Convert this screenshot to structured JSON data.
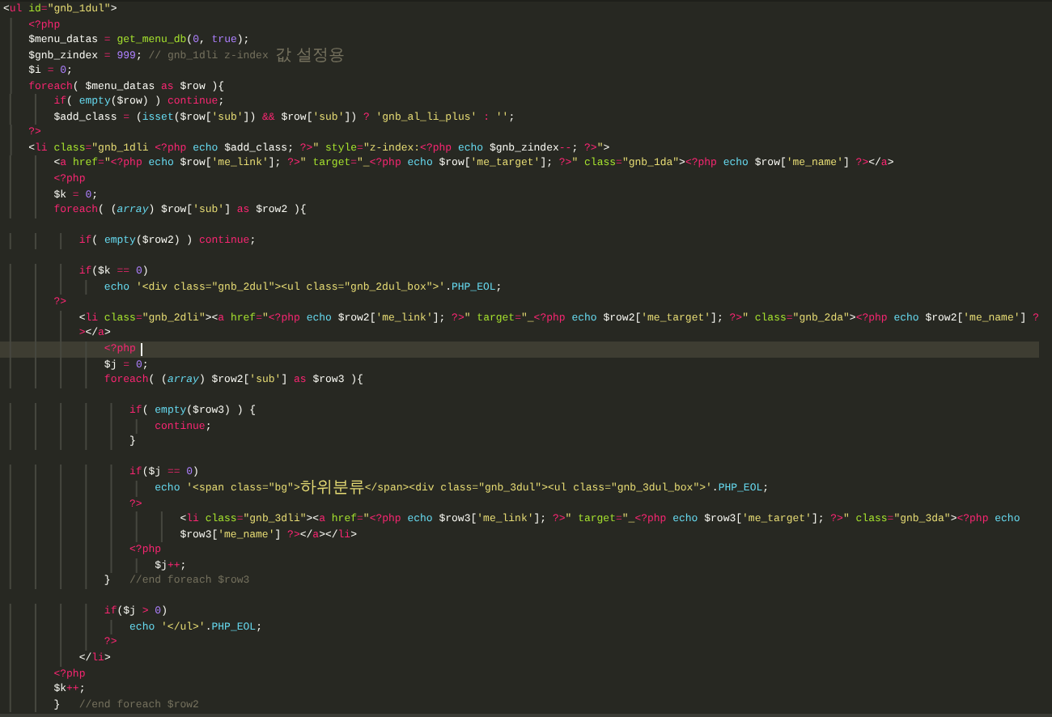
{
  "editor": {
    "lines": [
      {
        "current": false,
        "tokens": [
          {
            "kind": "w",
            "text": "<"
          },
          {
            "kind": "t",
            "text": "ul "
          },
          {
            "kind": "g",
            "text": "id"
          },
          {
            "kind": "t",
            "text": "="
          },
          {
            "kind": "y",
            "text": "\"gnb_1dul\""
          },
          {
            "kind": "w",
            "text": ">"
          }
        ]
      },
      {
        "current": false,
        "tokens": [
          {
            "kind": "t",
            "text": "    <?php"
          }
        ]
      },
      {
        "current": false,
        "tokens": [
          {
            "kind": "w",
            "text": "    $menu_datas "
          },
          {
            "kind": "t",
            "text": "= "
          },
          {
            "kind": "g",
            "text": "get_menu_db"
          },
          {
            "kind": "w",
            "text": "("
          },
          {
            "kind": "v",
            "text": "0"
          },
          {
            "kind": "w",
            "text": ", "
          },
          {
            "kind": "v",
            "text": "true"
          },
          {
            "kind": "w",
            "text": ");"
          }
        ]
      },
      {
        "current": false,
        "tokens": [
          {
            "kind": "w",
            "text": "    $gnb_zindex "
          },
          {
            "kind": "t",
            "text": "= "
          },
          {
            "kind": "v",
            "text": "999"
          },
          {
            "kind": "w",
            "text": "; "
          },
          {
            "kind": "c",
            "text": "// gnb_1dli z-index "
          },
          {
            "kind": "ck",
            "text": "값 설정용"
          }
        ]
      },
      {
        "current": false,
        "tokens": [
          {
            "kind": "w",
            "text": "    $i "
          },
          {
            "kind": "t",
            "text": "= "
          },
          {
            "kind": "v",
            "text": "0"
          },
          {
            "kind": "w",
            "text": ";"
          }
        ]
      },
      {
        "current": false,
        "tokens": [
          {
            "kind": "t",
            "text": "    foreach"
          },
          {
            "kind": "w",
            "text": "( $menu_datas "
          },
          {
            "kind": "t",
            "text": "as"
          },
          {
            "kind": "w",
            "text": " $row ){"
          }
        ]
      },
      {
        "current": false,
        "tokens": [
          {
            "kind": "t",
            "text": "        if"
          },
          {
            "kind": "w",
            "text": "( "
          },
          {
            "kind": "b",
            "text": "empty"
          },
          {
            "kind": "w",
            "text": "($row) ) "
          },
          {
            "kind": "t",
            "text": "continue"
          },
          {
            "kind": "w",
            "text": ";"
          }
        ]
      },
      {
        "current": false,
        "tokens": [
          {
            "kind": "w",
            "text": "        $add_class "
          },
          {
            "kind": "t",
            "text": "="
          },
          {
            "kind": "w",
            "text": " ("
          },
          {
            "kind": "b",
            "text": "isset"
          },
          {
            "kind": "w",
            "text": "($row["
          },
          {
            "kind": "y",
            "text": "'sub'"
          },
          {
            "kind": "w",
            "text": "]) "
          },
          {
            "kind": "t",
            "text": "&&"
          },
          {
            "kind": "w",
            "text": " $row["
          },
          {
            "kind": "y",
            "text": "'sub'"
          },
          {
            "kind": "w",
            "text": "]) "
          },
          {
            "kind": "t",
            "text": "? "
          },
          {
            "kind": "y",
            "text": "'gnb_al_li_plus' "
          },
          {
            "kind": "t",
            "text": ": "
          },
          {
            "kind": "y",
            "text": "''"
          },
          {
            "kind": "w",
            "text": ";"
          }
        ]
      },
      {
        "current": false,
        "tokens": [
          {
            "kind": "t",
            "text": "    ?>"
          }
        ]
      },
      {
        "current": false,
        "tokens": [
          {
            "kind": "w",
            "text": "    <"
          },
          {
            "kind": "t",
            "text": "li "
          },
          {
            "kind": "g",
            "text": "class"
          },
          {
            "kind": "t",
            "text": "="
          },
          {
            "kind": "y",
            "text": "\"gnb_1dli "
          },
          {
            "kind": "t",
            "text": "<?php "
          },
          {
            "kind": "b",
            "text": "echo"
          },
          {
            "kind": "w",
            "text": " $add_class; "
          },
          {
            "kind": "t",
            "text": "?>"
          },
          {
            "kind": "y",
            "text": "\" "
          },
          {
            "kind": "g",
            "text": "style"
          },
          {
            "kind": "t",
            "text": "="
          },
          {
            "kind": "y",
            "text": "\"z-index:"
          },
          {
            "kind": "t",
            "text": "<?php "
          },
          {
            "kind": "b",
            "text": "echo"
          },
          {
            "kind": "w",
            "text": " $gnb_zindex"
          },
          {
            "kind": "t",
            "text": "--"
          },
          {
            "kind": "w",
            "text": "; "
          },
          {
            "kind": "t",
            "text": "?>"
          },
          {
            "kind": "y",
            "text": "\""
          },
          {
            "kind": "w",
            "text": ">"
          }
        ]
      },
      {
        "current": false,
        "tokens": [
          {
            "kind": "w",
            "text": "        <"
          },
          {
            "kind": "t",
            "text": "a "
          },
          {
            "kind": "g",
            "text": "href"
          },
          {
            "kind": "t",
            "text": "="
          },
          {
            "kind": "y",
            "text": "\""
          },
          {
            "kind": "t",
            "text": "<?php "
          },
          {
            "kind": "b",
            "text": "echo"
          },
          {
            "kind": "w",
            "text": " $row["
          },
          {
            "kind": "y",
            "text": "'me_link'"
          },
          {
            "kind": "w",
            "text": "]; "
          },
          {
            "kind": "t",
            "text": "?>"
          },
          {
            "kind": "y",
            "text": "\" "
          },
          {
            "kind": "g",
            "text": "target"
          },
          {
            "kind": "t",
            "text": "="
          },
          {
            "kind": "y",
            "text": "\"_"
          },
          {
            "kind": "t",
            "text": "<?php "
          },
          {
            "kind": "b",
            "text": "echo"
          },
          {
            "kind": "w",
            "text": " $row["
          },
          {
            "kind": "y",
            "text": "'me_target'"
          },
          {
            "kind": "w",
            "text": "]; "
          },
          {
            "kind": "t",
            "text": "?>"
          },
          {
            "kind": "y",
            "text": "\" "
          },
          {
            "kind": "g",
            "text": "class"
          },
          {
            "kind": "t",
            "text": "="
          },
          {
            "kind": "y",
            "text": "\"gnb_1da\""
          },
          {
            "kind": "w",
            "text": ">"
          },
          {
            "kind": "t",
            "text": "<?php "
          },
          {
            "kind": "b",
            "text": "echo"
          },
          {
            "kind": "w",
            "text": " $row["
          },
          {
            "kind": "y",
            "text": "'me_name'"
          },
          {
            "kind": "w",
            "text": "] "
          },
          {
            "kind": "t",
            "text": "?>"
          },
          {
            "kind": "w",
            "text": "</"
          },
          {
            "kind": "t",
            "text": "a"
          },
          {
            "kind": "w",
            "text": ">"
          }
        ]
      },
      {
        "current": false,
        "tokens": [
          {
            "kind": "t",
            "text": "        <?php"
          }
        ]
      },
      {
        "current": false,
        "tokens": [
          {
            "kind": "w",
            "text": "        $k "
          },
          {
            "kind": "t",
            "text": "= "
          },
          {
            "kind": "v",
            "text": "0"
          },
          {
            "kind": "w",
            "text": ";"
          }
        ]
      },
      {
        "current": false,
        "tokens": [
          {
            "kind": "t",
            "text": "        foreach"
          },
          {
            "kind": "w",
            "text": "( ("
          },
          {
            "kind": "bi",
            "text": "array"
          },
          {
            "kind": "w",
            "text": ") $row["
          },
          {
            "kind": "y",
            "text": "'sub'"
          },
          {
            "kind": "w",
            "text": "] "
          },
          {
            "kind": "t",
            "text": "as"
          },
          {
            "kind": "w",
            "text": " $row2 ){"
          }
        ]
      },
      {
        "current": false
      },
      {
        "current": false,
        "tokens": [
          {
            "kind": "t",
            "text": "            if"
          },
          {
            "kind": "w",
            "text": "( "
          },
          {
            "kind": "b",
            "text": "empty"
          },
          {
            "kind": "w",
            "text": "($row2) ) "
          },
          {
            "kind": "t",
            "text": "continue"
          },
          {
            "kind": "w",
            "text": ";"
          }
        ]
      },
      {
        "current": false
      },
      {
        "current": false,
        "tokens": [
          {
            "kind": "t",
            "text": "            if"
          },
          {
            "kind": "w",
            "text": "($k "
          },
          {
            "kind": "t",
            "text": "== "
          },
          {
            "kind": "v",
            "text": "0"
          },
          {
            "kind": "w",
            "text": ")"
          }
        ]
      },
      {
        "current": false,
        "tokens": [
          {
            "kind": "b",
            "text": "                echo "
          },
          {
            "kind": "y",
            "text": "'<div class=\"gnb_2dul\"><ul class=\"gnb_2dul_box\">'"
          },
          {
            "kind": "w",
            "text": "."
          },
          {
            "kind": "b",
            "text": "PHP_EOL"
          },
          {
            "kind": "w",
            "text": ";"
          }
        ]
      },
      {
        "current": false,
        "tokens": [
          {
            "kind": "t",
            "text": "        ?>"
          }
        ]
      },
      {
        "current": false,
        "tokens": [
          {
            "kind": "w",
            "text": "            <"
          },
          {
            "kind": "t",
            "text": "li "
          },
          {
            "kind": "g",
            "text": "class"
          },
          {
            "kind": "t",
            "text": "="
          },
          {
            "kind": "y",
            "text": "\"gnb_2dli\""
          },
          {
            "kind": "w",
            "text": "><"
          },
          {
            "kind": "t",
            "text": "a "
          },
          {
            "kind": "g",
            "text": "href"
          },
          {
            "kind": "t",
            "text": "="
          },
          {
            "kind": "y",
            "text": "\""
          },
          {
            "kind": "t",
            "text": "<?php "
          },
          {
            "kind": "b",
            "text": "echo"
          },
          {
            "kind": "w",
            "text": " $row2["
          },
          {
            "kind": "y",
            "text": "'me_link'"
          },
          {
            "kind": "w",
            "text": "]; "
          },
          {
            "kind": "t",
            "text": "?>"
          },
          {
            "kind": "y",
            "text": "\" "
          },
          {
            "kind": "g",
            "text": "target"
          },
          {
            "kind": "t",
            "text": "="
          },
          {
            "kind": "y",
            "text": "\"_"
          },
          {
            "kind": "t",
            "text": "<?php "
          },
          {
            "kind": "b",
            "text": "echo"
          },
          {
            "kind": "w",
            "text": " $row2["
          },
          {
            "kind": "y",
            "text": "'me_target'"
          },
          {
            "kind": "w",
            "text": "]; "
          },
          {
            "kind": "t",
            "text": "?>"
          },
          {
            "kind": "y",
            "text": "\" "
          },
          {
            "kind": "g",
            "text": "class"
          },
          {
            "kind": "t",
            "text": "="
          },
          {
            "kind": "y",
            "text": "\"gnb_2da\""
          },
          {
            "kind": "w",
            "text": ">"
          },
          {
            "kind": "t",
            "text": "<?php "
          },
          {
            "kind": "b",
            "text": "echo"
          },
          {
            "kind": "w",
            "text": " $row2["
          },
          {
            "kind": "y",
            "text": "'me_name'"
          },
          {
            "kind": "w",
            "text": "] "
          },
          {
            "kind": "t",
            "text": "?"
          }
        ]
      },
      {
        "current": false,
        "tokens": [
          {
            "kind": "t",
            "text": "            >"
          },
          {
            "kind": "w",
            "text": "</"
          },
          {
            "kind": "t",
            "text": "a"
          },
          {
            "kind": "w",
            "text": ">"
          }
        ]
      },
      {
        "current": true,
        "tokens": [
          {
            "kind": "t",
            "text": "                <?php"
          }
        ]
      },
      {
        "current": false,
        "tokens": [
          {
            "kind": "w",
            "text": "                $j "
          },
          {
            "kind": "t",
            "text": "= "
          },
          {
            "kind": "v",
            "text": "0"
          },
          {
            "kind": "w",
            "text": ";"
          }
        ]
      },
      {
        "current": false,
        "tokens": [
          {
            "kind": "t",
            "text": "                foreach"
          },
          {
            "kind": "w",
            "text": "( ("
          },
          {
            "kind": "bi",
            "text": "array"
          },
          {
            "kind": "w",
            "text": ") $row2["
          },
          {
            "kind": "y",
            "text": "'sub'"
          },
          {
            "kind": "w",
            "text": "] "
          },
          {
            "kind": "t",
            "text": "as"
          },
          {
            "kind": "w",
            "text": " $row3 ){"
          }
        ]
      },
      {
        "current": false
      },
      {
        "current": false,
        "tokens": [
          {
            "kind": "t",
            "text": "                    if"
          },
          {
            "kind": "w",
            "text": "( "
          },
          {
            "kind": "b",
            "text": "empty"
          },
          {
            "kind": "w",
            "text": "($row3) ) {"
          }
        ]
      },
      {
        "current": false,
        "tokens": [
          {
            "kind": "t",
            "text": "                        continue"
          },
          {
            "kind": "w",
            "text": ";"
          }
        ]
      },
      {
        "current": false,
        "tokens": [
          {
            "kind": "w",
            "text": "                    }"
          }
        ]
      },
      {
        "current": false
      },
      {
        "current": false,
        "tokens": [
          {
            "kind": "t",
            "text": "                    if"
          },
          {
            "kind": "w",
            "text": "($j "
          },
          {
            "kind": "t",
            "text": "== "
          },
          {
            "kind": "v",
            "text": "0"
          },
          {
            "kind": "w",
            "text": ")"
          }
        ]
      },
      {
        "current": false,
        "tokens": [
          {
            "kind": "b",
            "text": "                        echo "
          },
          {
            "kind": "y",
            "text": "'<span class=\"bg\">"
          },
          {
            "kind": "yk",
            "text": "하위분류"
          },
          {
            "kind": "y",
            "text": "</span><div class=\"gnb_3dul\"><ul class=\"gnb_3dul_box\">'"
          },
          {
            "kind": "w",
            "text": "."
          },
          {
            "kind": "b",
            "text": "PHP_EOL"
          },
          {
            "kind": "w",
            "text": ";"
          }
        ]
      },
      {
        "current": false,
        "tokens": [
          {
            "kind": "t",
            "text": "                    ?>"
          }
        ]
      },
      {
        "current": false,
        "tokens": [
          {
            "kind": "w",
            "text": "                            <"
          },
          {
            "kind": "t",
            "text": "li "
          },
          {
            "kind": "g",
            "text": "class"
          },
          {
            "kind": "t",
            "text": "="
          },
          {
            "kind": "y",
            "text": "\"gnb_3dli\""
          },
          {
            "kind": "w",
            "text": "><"
          },
          {
            "kind": "t",
            "text": "a "
          },
          {
            "kind": "g",
            "text": "href"
          },
          {
            "kind": "t",
            "text": "="
          },
          {
            "kind": "y",
            "text": "\""
          },
          {
            "kind": "t",
            "text": "<?php "
          },
          {
            "kind": "b",
            "text": "echo"
          },
          {
            "kind": "w",
            "text": " $row3["
          },
          {
            "kind": "y",
            "text": "'me_link'"
          },
          {
            "kind": "w",
            "text": "]; "
          },
          {
            "kind": "t",
            "text": "?>"
          },
          {
            "kind": "y",
            "text": "\" "
          },
          {
            "kind": "g",
            "text": "target"
          },
          {
            "kind": "t",
            "text": "="
          },
          {
            "kind": "y",
            "text": "\"_"
          },
          {
            "kind": "t",
            "text": "<?php "
          },
          {
            "kind": "b",
            "text": "echo"
          },
          {
            "kind": "w",
            "text": " $row3["
          },
          {
            "kind": "y",
            "text": "'me_target'"
          },
          {
            "kind": "w",
            "text": "]; "
          },
          {
            "kind": "t",
            "text": "?>"
          },
          {
            "kind": "y",
            "text": "\" "
          },
          {
            "kind": "g",
            "text": "class"
          },
          {
            "kind": "t",
            "text": "="
          },
          {
            "kind": "y",
            "text": "\"gnb_3da\""
          },
          {
            "kind": "w",
            "text": ">"
          },
          {
            "kind": "t",
            "text": "<?php "
          },
          {
            "kind": "b",
            "text": "echo"
          }
        ]
      },
      {
        "current": false,
        "tokens": [
          {
            "kind": "w",
            "text": "                            $row3["
          },
          {
            "kind": "y",
            "text": "'me_name'"
          },
          {
            "kind": "w",
            "text": "] "
          },
          {
            "kind": "t",
            "text": "?>"
          },
          {
            "kind": "w",
            "text": "</"
          },
          {
            "kind": "t",
            "text": "a"
          },
          {
            "kind": "w",
            "text": "></"
          },
          {
            "kind": "t",
            "text": "li"
          },
          {
            "kind": "w",
            "text": ">"
          }
        ]
      },
      {
        "current": false,
        "tokens": [
          {
            "kind": "t",
            "text": "                    <?php"
          }
        ]
      },
      {
        "current": false,
        "tokens": [
          {
            "kind": "w",
            "text": "                        $j"
          },
          {
            "kind": "t",
            "text": "++"
          },
          {
            "kind": "w",
            "text": ";"
          }
        ]
      },
      {
        "current": false,
        "tokens": [
          {
            "kind": "w",
            "text": "                }   "
          },
          {
            "kind": "c",
            "text": "//end foreach $row3"
          }
        ]
      },
      {
        "current": false
      },
      {
        "current": false,
        "tokens": [
          {
            "kind": "t",
            "text": "                if"
          },
          {
            "kind": "w",
            "text": "($j "
          },
          {
            "kind": "t",
            "text": "> "
          },
          {
            "kind": "v",
            "text": "0"
          },
          {
            "kind": "w",
            "text": ")"
          }
        ]
      },
      {
        "current": false,
        "tokens": [
          {
            "kind": "b",
            "text": "                    echo "
          },
          {
            "kind": "y",
            "text": "'</ul>'"
          },
          {
            "kind": "w",
            "text": "."
          },
          {
            "kind": "b",
            "text": "PHP_EOL"
          },
          {
            "kind": "w",
            "text": ";"
          }
        ]
      },
      {
        "current": false,
        "tokens": [
          {
            "kind": "t",
            "text": "                ?>"
          }
        ]
      },
      {
        "current": false,
        "tokens": [
          {
            "kind": "w",
            "text": "            </"
          },
          {
            "kind": "t",
            "text": "li"
          },
          {
            "kind": "w",
            "text": ">"
          }
        ]
      },
      {
        "current": false,
        "tokens": [
          {
            "kind": "t",
            "text": "        <?php"
          }
        ]
      },
      {
        "current": false,
        "tokens": [
          {
            "kind": "w",
            "text": "        $k"
          },
          {
            "kind": "t",
            "text": "++"
          },
          {
            "kind": "w",
            "text": ";"
          }
        ]
      },
      {
        "current": false,
        "tokens": [
          {
            "kind": "w",
            "text": "        }   "
          },
          {
            "kind": "c",
            "text": "//end foreach $row2"
          }
        ]
      }
    ]
  }
}
